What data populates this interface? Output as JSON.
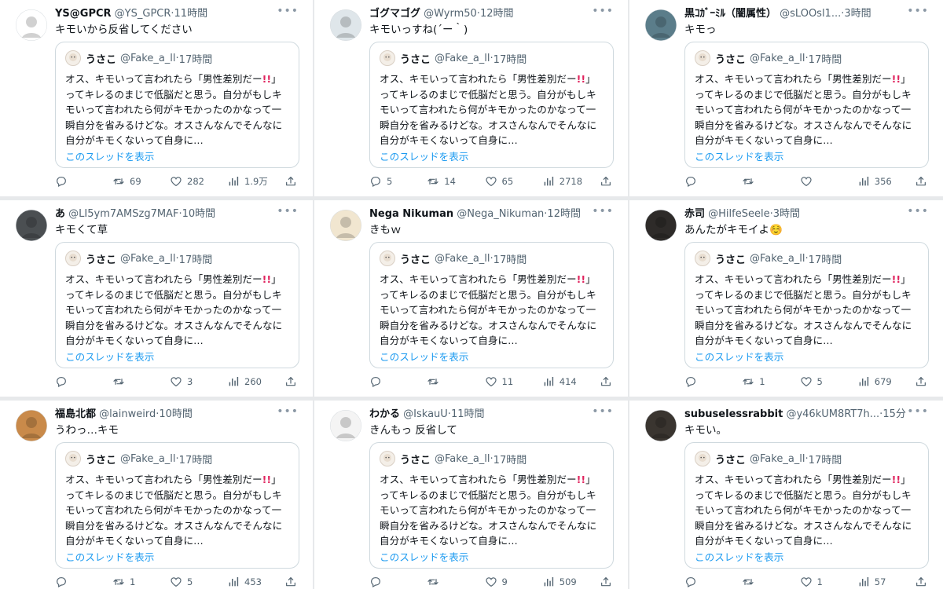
{
  "quote": {
    "name": "うさこ",
    "handle": "@Fake_a_ll",
    "time": "17時間",
    "text_a": "オス、キモいって言われたら「男性差別だー",
    "text_b": "」ってキレるのまじで低脳だと思う。自分がもしキモいって言われたら何がキモかったのかなって一瞬自分を省みるけどな。オスさんなんでそんなに自分がキモくないって自身に…",
    "show_thread": "このスレッドを表示",
    "dot": "·"
  },
  "tweets": [
    {
      "name": "YS@GPCR",
      "handle": "@YS_GPCR",
      "time": "11時間",
      "text": "キモいから反省してください",
      "reply": "",
      "retweet": "69",
      "like": "282",
      "views": "1.9万",
      "avatar_color": "#ffffff"
    },
    {
      "name": "ゴグマゴグ",
      "handle": "@Wyrm50",
      "time": "12時間",
      "text": "キモいっすね(´ー｀)",
      "reply": "5",
      "retweet": "14",
      "like": "65",
      "views": "2718",
      "avatar_color": "#dfe6ea"
    },
    {
      "name": "黒ｺｶﾞｰﾐﾙ（闇属性）",
      "handle": "@sLOOsl1...",
      "time": "3時間",
      "text": "キモっ",
      "reply": "",
      "retweet": "",
      "like": "",
      "views": "356",
      "avatar_color": "#5b7d8a"
    },
    {
      "name": "あ",
      "handle": "@LI5ym7AMSzg7MAF",
      "time": "10時間",
      "text": "キモくて草",
      "reply": "",
      "retweet": "",
      "like": "3",
      "views": "260",
      "avatar_color": "#4b4f52"
    },
    {
      "name": "Nega Nikuman",
      "handle": "@Nega_Nikuman",
      "time": "12時間",
      "text": "きもｗ",
      "reply": "",
      "retweet": "",
      "like": "11",
      "views": "414",
      "avatar_color": "#f1e6d0"
    },
    {
      "name": "赤司",
      "handle": "@HilfeSeele",
      "time": "3時間",
      "text": "あんたがキモイよ☺️",
      "reply": "",
      "retweet": "1",
      "like": "5",
      "views": "679",
      "avatar_color": "#2e2b29"
    },
    {
      "name": "福島北都",
      "handle": "@lainweird",
      "time": "10時間",
      "text": "うわっ…キモ",
      "reply": "",
      "retweet": "1",
      "like": "5",
      "views": "453",
      "avatar_color": "#c98a4a"
    },
    {
      "name": "わかる",
      "handle": "@IskauU",
      "time": "11時間",
      "text": "きんもっ 反省して",
      "reply": "",
      "retweet": "",
      "like": "9",
      "views": "509",
      "avatar_color": "#f4f4f4"
    },
    {
      "name": "subuselessrabbit",
      "handle": "@y46kUM8RT7h...",
      "time": "15分",
      "text": "キモい。",
      "reply": "",
      "retweet": "",
      "like": "1",
      "views": "57",
      "avatar_color": "#3a3530"
    }
  ]
}
